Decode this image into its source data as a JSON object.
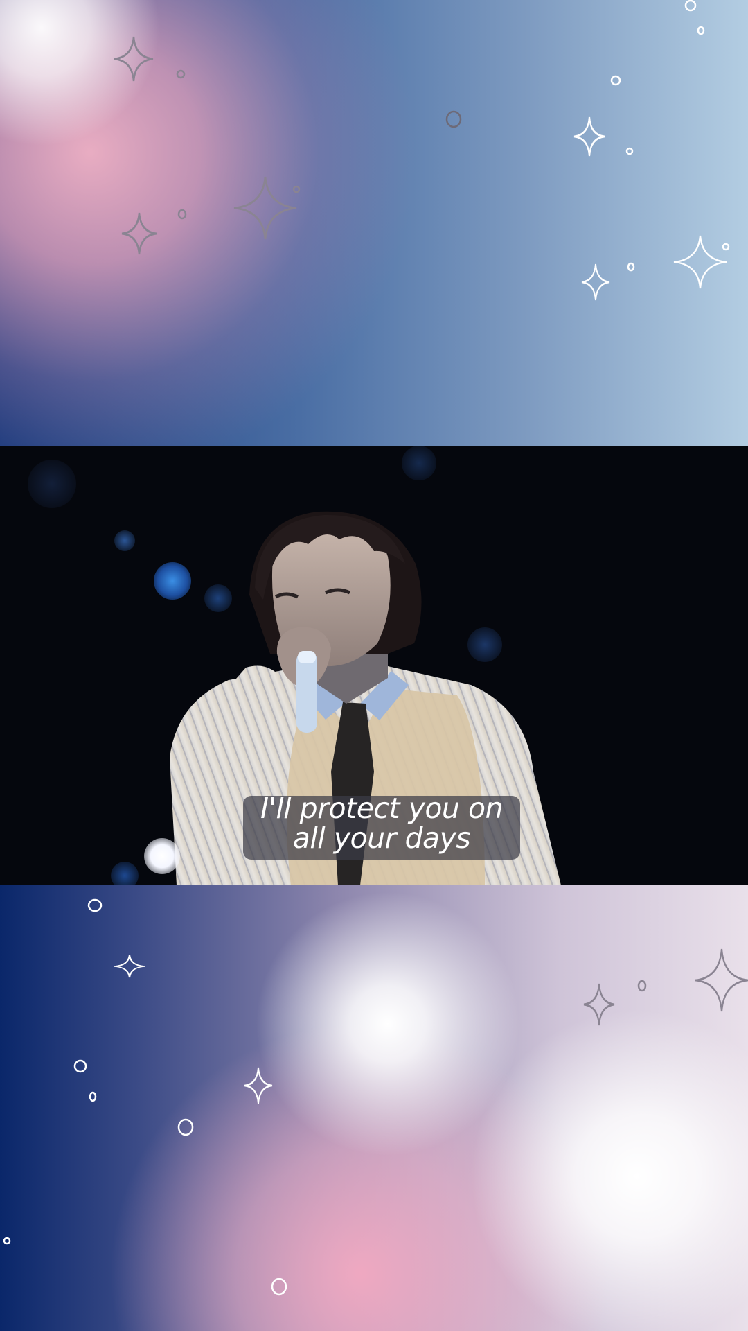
{
  "caption": {
    "line1": "I'll protect you on",
    "line2": "all your days"
  },
  "colors": {
    "caption_bg": "#3c3c46",
    "caption_text": "#ffffff",
    "sparkle_white": "#ffffff",
    "sparkle_gray": "#8a8492",
    "video_bg": "#05070d"
  },
  "decorations": {
    "sparkle_icon": "four-point-star",
    "bubble_icon": "small-circle"
  }
}
